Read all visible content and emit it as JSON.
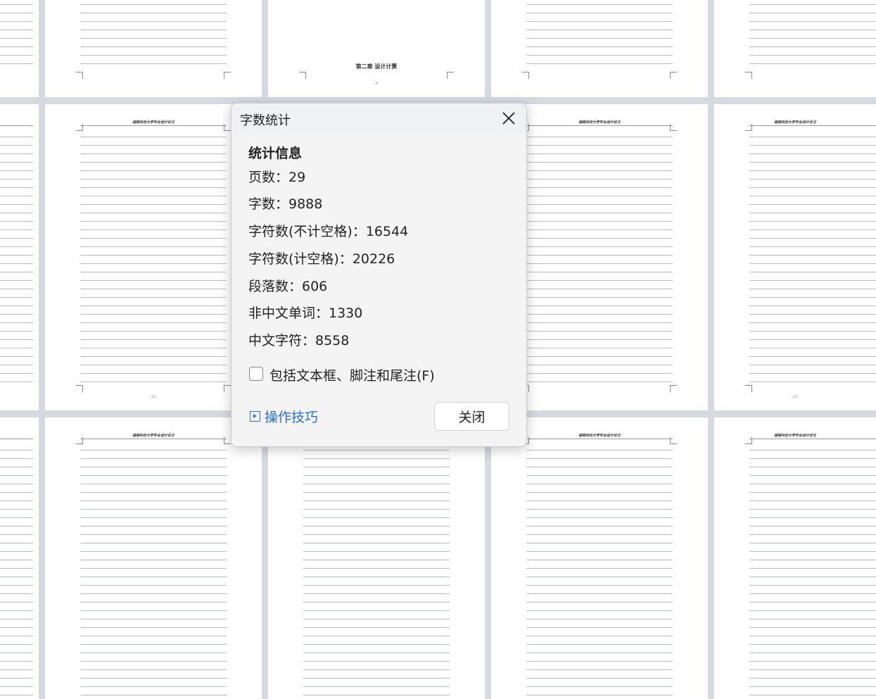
{
  "document": {
    "page_header": "湖南科技大学毕业设计论文",
    "chapter_heading": "第二章  设计计算",
    "page_numbers": [
      "-4-",
      "-10-",
      "-11-"
    ]
  },
  "dialog": {
    "title": "字数统计",
    "section_title": "统计信息",
    "stats": [
      {
        "label": "页数：29"
      },
      {
        "label": "字数：9888"
      },
      {
        "label": "字符数(不计空格)：16544"
      },
      {
        "label": "字符数(计空格)：20226"
      },
      {
        "label": "段落数：606"
      },
      {
        "label": "非中文单词：1330"
      },
      {
        "label": "中文字符：8558"
      }
    ],
    "include_checkbox_label": "包括文本框、脚注和尾注(F)",
    "include_checked": false,
    "tips_label": "操作技巧",
    "close_label": "关闭"
  }
}
